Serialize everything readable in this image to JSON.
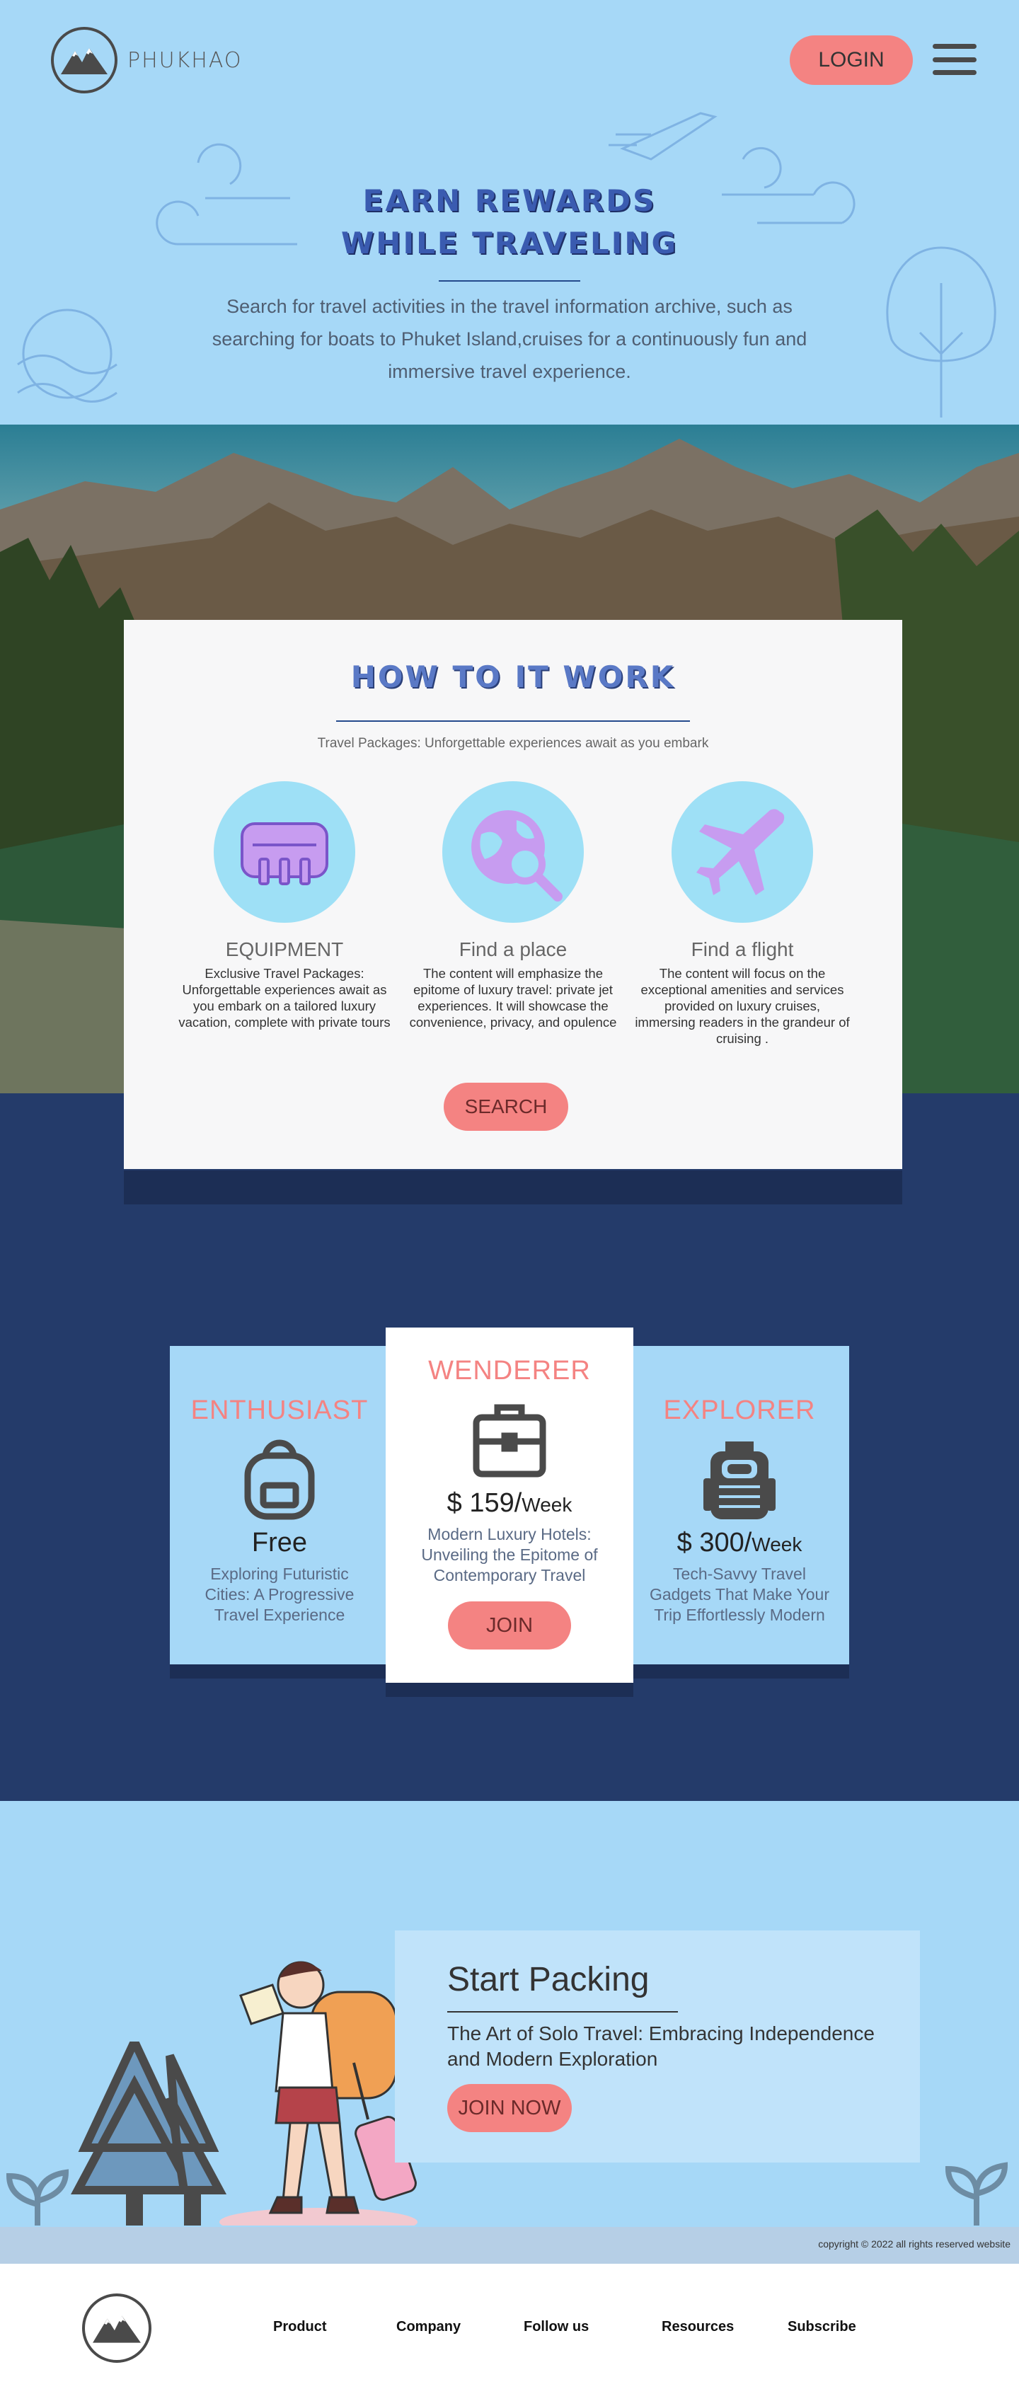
{
  "header": {
    "brand": "PHUKHAO",
    "login_label": "LOGIN"
  },
  "hero": {
    "title_line1": "EARN REWARDS",
    "title_line2": "WHILE TRAVELING",
    "description": "Search for travel activities in the travel information archive, such as searching for boats to Phuket Island,cruises for a continuously fun and immersive travel experience."
  },
  "how": {
    "title": "HOW TO IT WORK",
    "subtitle": "Travel Packages: Unforgettable experiences await as you embark",
    "features": [
      {
        "title": "EQUIPMENT",
        "icon": "luggage-icon",
        "desc": "Exclusive Travel Packages: Unforgettable experiences await as you embark on a tailored luxury vacation, complete with private tours"
      },
      {
        "title": "Find a place",
        "icon": "globe-search-icon",
        "desc": "The content will emphasize the epitome of luxury travel: private jet experiences. It will showcase the convenience, privacy, and opulence"
      },
      {
        "title": "Find a flight",
        "icon": "airplane-icon",
        "desc": "The content will focus on the exceptional amenities and services provided on luxury cruises, immersing readers in the grandeur of cruising ."
      }
    ],
    "search_label": "SEARCH"
  },
  "plans": [
    {
      "name": "ENTHUSIAST",
      "icon": "backpack-icon",
      "price": "Free",
      "per": "",
      "desc": "Exploring Futuristic Cities: A Progressive Travel Experience"
    },
    {
      "name": "WENDERER",
      "icon": "briefcase-icon",
      "price": "$ 159/",
      "per": "Week",
      "desc": "Modern Luxury Hotels: Unveiling the Epitome of Contemporary Travel",
      "button": "JOIN"
    },
    {
      "name": "EXPLORER",
      "icon": "hiking-backpack-icon",
      "price": "$ 300/",
      "per": "Week",
      "desc": "Tech-Savvy Travel Gadgets That Make Your Trip Effortlessly Modern"
    }
  ],
  "packing": {
    "title": "Start Packing",
    "description": "The Art of Solo Travel: Embracing Independence and Modern Exploration",
    "button": "JOIN NOW",
    "copyright": "copyright © 2022 all rights reserved  website"
  },
  "footer": {
    "links": [
      "Product",
      "Company",
      "Follow us",
      "Resources",
      "Subscribe"
    ]
  },
  "colors": {
    "sky": "#a6d8f7",
    "navy": "#243b6a",
    "accent": "#f48382",
    "title_blue": "#3a5bb0"
  }
}
